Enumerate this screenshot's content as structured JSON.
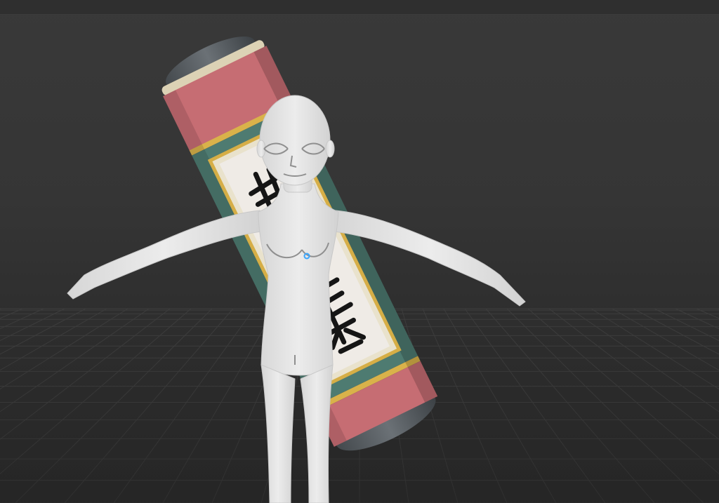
{
  "viewport": {
    "background": "#353535",
    "grid_color": "#3f3f3f"
  },
  "scroll_object": {
    "kind": "hanging-scroll-pillar",
    "colors": {
      "end_cap": "#5b6166",
      "cream_band": "#ddd4b8",
      "pink_band": "#c97075",
      "gold_trim": "#d8b14b",
      "green_band": "#4f7c72",
      "paper": "#eee9e3",
      "ink": "#161616"
    },
    "icon": "kanji-brush-strokes"
  },
  "character_model": {
    "pose": "a-pose",
    "material_color": "#e3e3e3",
    "icon": "humanoid-base-mesh"
  },
  "origin_marker": {
    "color": "#3aa6ff",
    "icon": "object-origin-dot"
  }
}
